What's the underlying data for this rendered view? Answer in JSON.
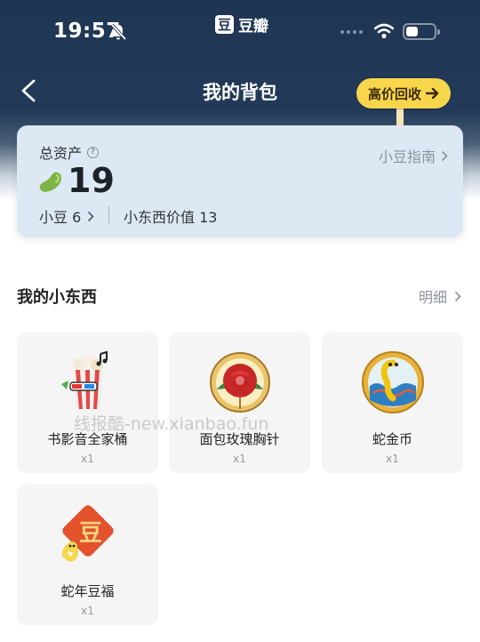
{
  "status_bar": {
    "time": "19:57",
    "app_name": "豆瓣",
    "app_icon_char": "豆"
  },
  "header": {
    "title": "我的背包",
    "recycle_button": "高价回收"
  },
  "assets": {
    "label": "总资产",
    "help_icon": "?",
    "guide_link": "小豆指南",
    "total": "19",
    "beans_label": "小豆 6",
    "items_value_label": "小东西价值 13"
  },
  "section": {
    "title": "我的小东西",
    "detail_link": "明细"
  },
  "items": [
    {
      "name": "书影音全家桶",
      "qty": "x1",
      "icon": "popcorn-bucket-icon"
    },
    {
      "name": "面包玫瑰胸针",
      "qty": "x1",
      "icon": "rose-brooch-icon"
    },
    {
      "name": "蛇金币",
      "qty": "x1",
      "icon": "snake-coin-icon"
    },
    {
      "name": "蛇年豆福",
      "qty": "x1",
      "icon": "snake-fu-icon",
      "badge_char": "豆"
    }
  ],
  "watermark": "线报酷-new.xianbao.fun",
  "colors": {
    "header_navy": "#1e3553",
    "recycle_yellow": "#f8d64c",
    "card_blue": "#dce9f5",
    "bean_green": "#7cb342"
  }
}
